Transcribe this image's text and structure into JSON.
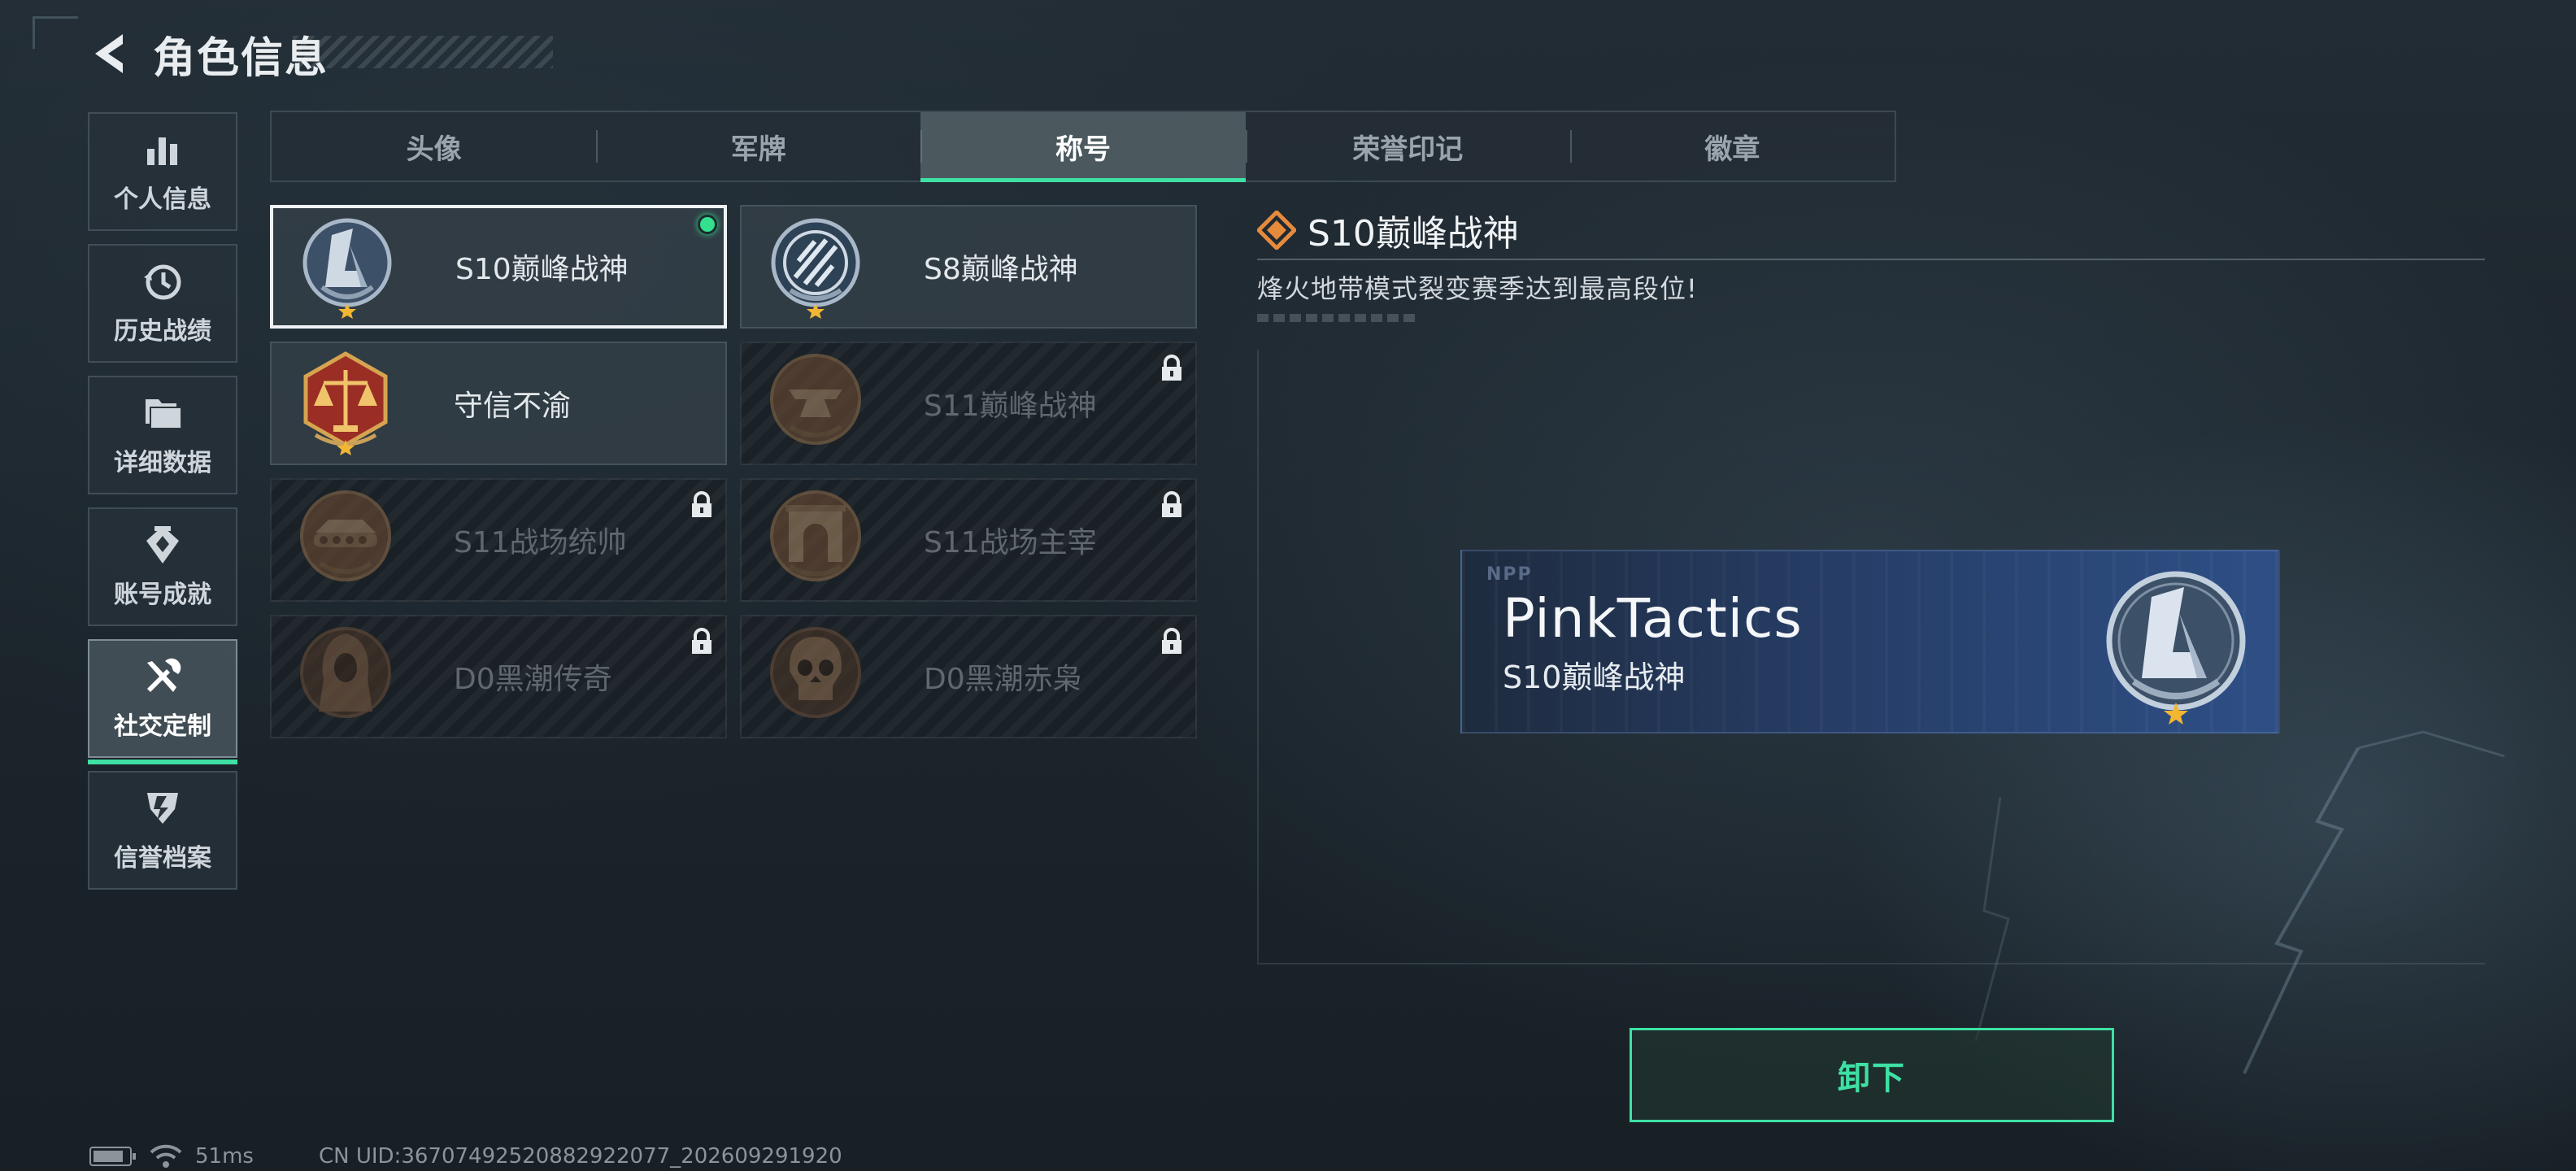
{
  "header": {
    "title": "角色信息"
  },
  "sidebar": {
    "items": [
      {
        "label": "个人信息",
        "icon": "bar-chart-icon"
      },
      {
        "label": "历史战绩",
        "icon": "history-clock-icon"
      },
      {
        "label": "详细数据",
        "icon": "folder-icon"
      },
      {
        "label": "账号成就",
        "icon": "achievement-badge-icon"
      },
      {
        "label": "社交定制",
        "icon": "tools-icon",
        "active": true
      },
      {
        "label": "信誉档案",
        "icon": "shield-emblem-icon"
      }
    ]
  },
  "tabs": [
    {
      "label": "头像"
    },
    {
      "label": "军牌"
    },
    {
      "label": "称号",
      "active": true
    },
    {
      "label": "荣誉印记"
    },
    {
      "label": "徽章"
    }
  ],
  "titles": [
    {
      "name": "S10巅峰战神",
      "locked": false,
      "selected": true,
      "equipped": true
    },
    {
      "name": "S8巅峰战神",
      "locked": false
    },
    {
      "name": "守信不渝",
      "locked": false
    },
    {
      "name": "S11巅峰战神",
      "locked": true
    },
    {
      "name": "S11战场统帅",
      "locked": true
    },
    {
      "name": "S11战场主宰",
      "locked": true
    },
    {
      "name": "D0黑潮传奇",
      "locked": true
    },
    {
      "name": "D0黑潮赤枭",
      "locked": true
    }
  ],
  "detail": {
    "title": "S10巅峰战神",
    "description": "烽火地带模式裂变赛季达到最高段位!",
    "banner": {
      "player_name": "PinkTactics",
      "title": "S10巅峰战神",
      "tag": "NPP"
    },
    "action_label": "卸下"
  },
  "status_bar": {
    "ping": "51ms",
    "uid": "CN UID:3670749252088292207​7_202609291920"
  },
  "colors": {
    "accent": "#3ee0a4",
    "equipped_dot": "#33e08e",
    "detail_icon": "#e68a3c"
  }
}
